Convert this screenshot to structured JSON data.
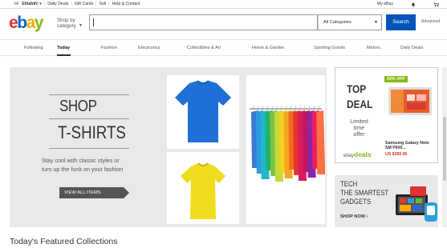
{
  "topbar": {
    "greeting_prefix": "Hi ",
    "user": "Elitabih!",
    "links": [
      "Daily Deals",
      "Gift Cards",
      "Sell",
      "Help & Contact"
    ],
    "my_ebay": "My eBay"
  },
  "header": {
    "logo": {
      "e": "e",
      "b": "b",
      "a": "a",
      "y": "y"
    },
    "shop_by_line1": "Shop by",
    "shop_by_line2": "category",
    "search_value": "",
    "category_selected": "All Categories",
    "search_label": "Search",
    "advanced_label": "Advanced"
  },
  "nav": [
    "Following",
    "Today",
    "Fashion",
    "Electronics",
    "Collectibles & Art",
    "Home & Garden",
    "Sporting Goods",
    "Motors",
    "Daily Deals"
  ],
  "hero": {
    "title_line1": "SHOP",
    "title_line2": "T-SHIRTS",
    "tagline1": "Stay cool with classic styles or",
    "tagline2": "turn up the funk on your fashion",
    "cta": "VIEW ALL ITEMS"
  },
  "deal": {
    "title1": "TOP",
    "title2": "DEAL",
    "limited1": "Limited",
    "limited2": "time",
    "limited3": "offer",
    "badge": "42% OFF",
    "product1": "Samsung Galaxy Note",
    "product2": "SM P600...",
    "price": "US $289.96",
    "brand_ebay": "ebay",
    "brand_deals": "deals"
  },
  "tech": {
    "line1": "TECH",
    "line2": "THE SMARTEST",
    "line3": "GADGETS",
    "cta": "SHOP NOW ›"
  },
  "featured_heading": "Today's Featured Collections",
  "colors": {
    "ebay_red": "#e53238",
    "ebay_blue": "#0064d2",
    "ebay_yellow": "#f5af02",
    "ebay_green": "#86b817",
    "search_button": "#0654ba",
    "deal_badge": "#86b817",
    "price_red": "#dd3322",
    "blue_shirt": "#1f6fd6",
    "yellow_shirt": "#f0dc1e"
  }
}
